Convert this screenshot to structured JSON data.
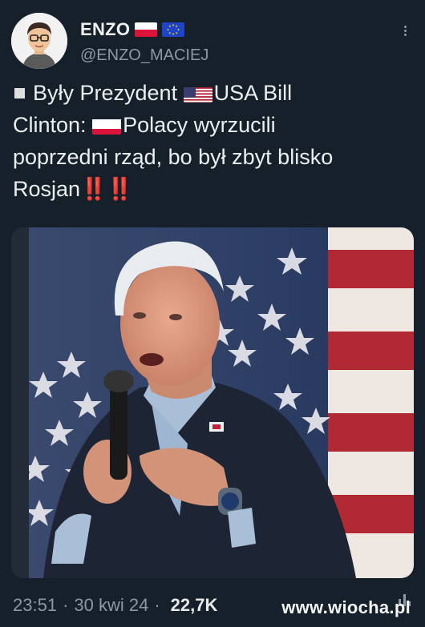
{
  "author": {
    "name": "ENZO",
    "handle": "@ENZO_MACIEJ",
    "flags": [
      "poland-flag",
      "eu-flag"
    ]
  },
  "tweet": {
    "line1_prefix": "Były Prezydent ",
    "line1_flag": "usa-flag",
    "line1_suffix": "USA Bill",
    "line2_prefix": "Clinton: ",
    "line2_flag": "poland-flag",
    "line2_suffix": "Polacy wyrzucili",
    "line3": "poprzedni rząd, bo był zbyt blisko",
    "line4": "Rosjan",
    "line4_emoji": "‼️‼️"
  },
  "footer": {
    "time": "23:51",
    "date": "30 kwi 24",
    "views": "22,7K",
    "separator": "·"
  },
  "watermark": "www.wiocha.pl",
  "colors": {
    "background": "#15202b",
    "text": "#e7e9ea",
    "muted": "#8b98a5",
    "accent_red": "#e0262a"
  }
}
